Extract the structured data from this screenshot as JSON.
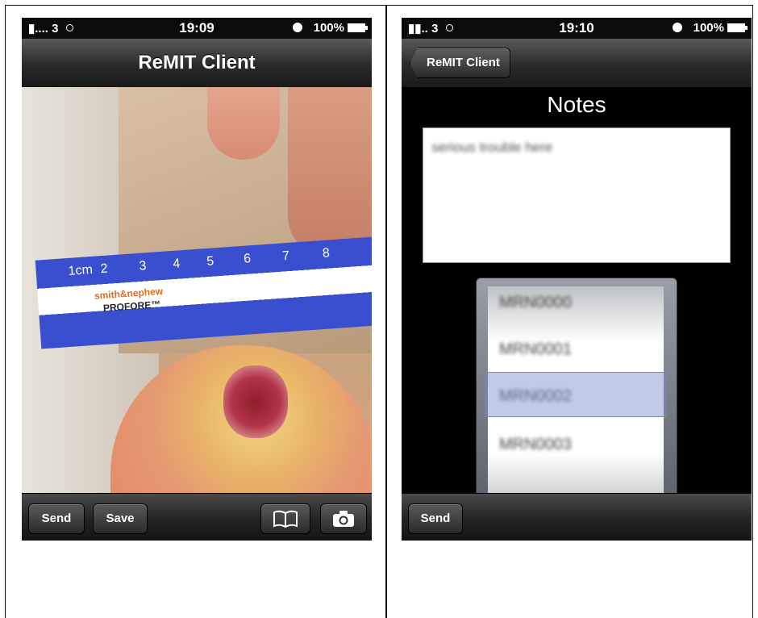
{
  "left_screen": {
    "status": {
      "carrier": "3",
      "time": "19:09",
      "battery": "100%"
    },
    "navbar": {
      "title": "ReMIT Client"
    },
    "ruler": {
      "ticks": [
        "1cm",
        "2",
        "3",
        "4",
        "5",
        "6",
        "7",
        "8"
      ],
      "brand": "smith&nephew",
      "product": "PROFORE™"
    },
    "toolbar": {
      "send_label": "Send",
      "save_label": "Save"
    }
  },
  "right_screen": {
    "status": {
      "carrier": "3",
      "time": "19:10",
      "battery": "100%"
    },
    "navbar": {
      "back_label": "ReMIT Client"
    },
    "notes": {
      "title": "Notes",
      "text": "serious trouble here"
    },
    "picker": {
      "rows": [
        "MRN0000",
        "MRN0001",
        "MRN0002",
        "MRN0003"
      ],
      "selected": "MRN0002"
    },
    "toolbar": {
      "send_label": "Send"
    }
  }
}
